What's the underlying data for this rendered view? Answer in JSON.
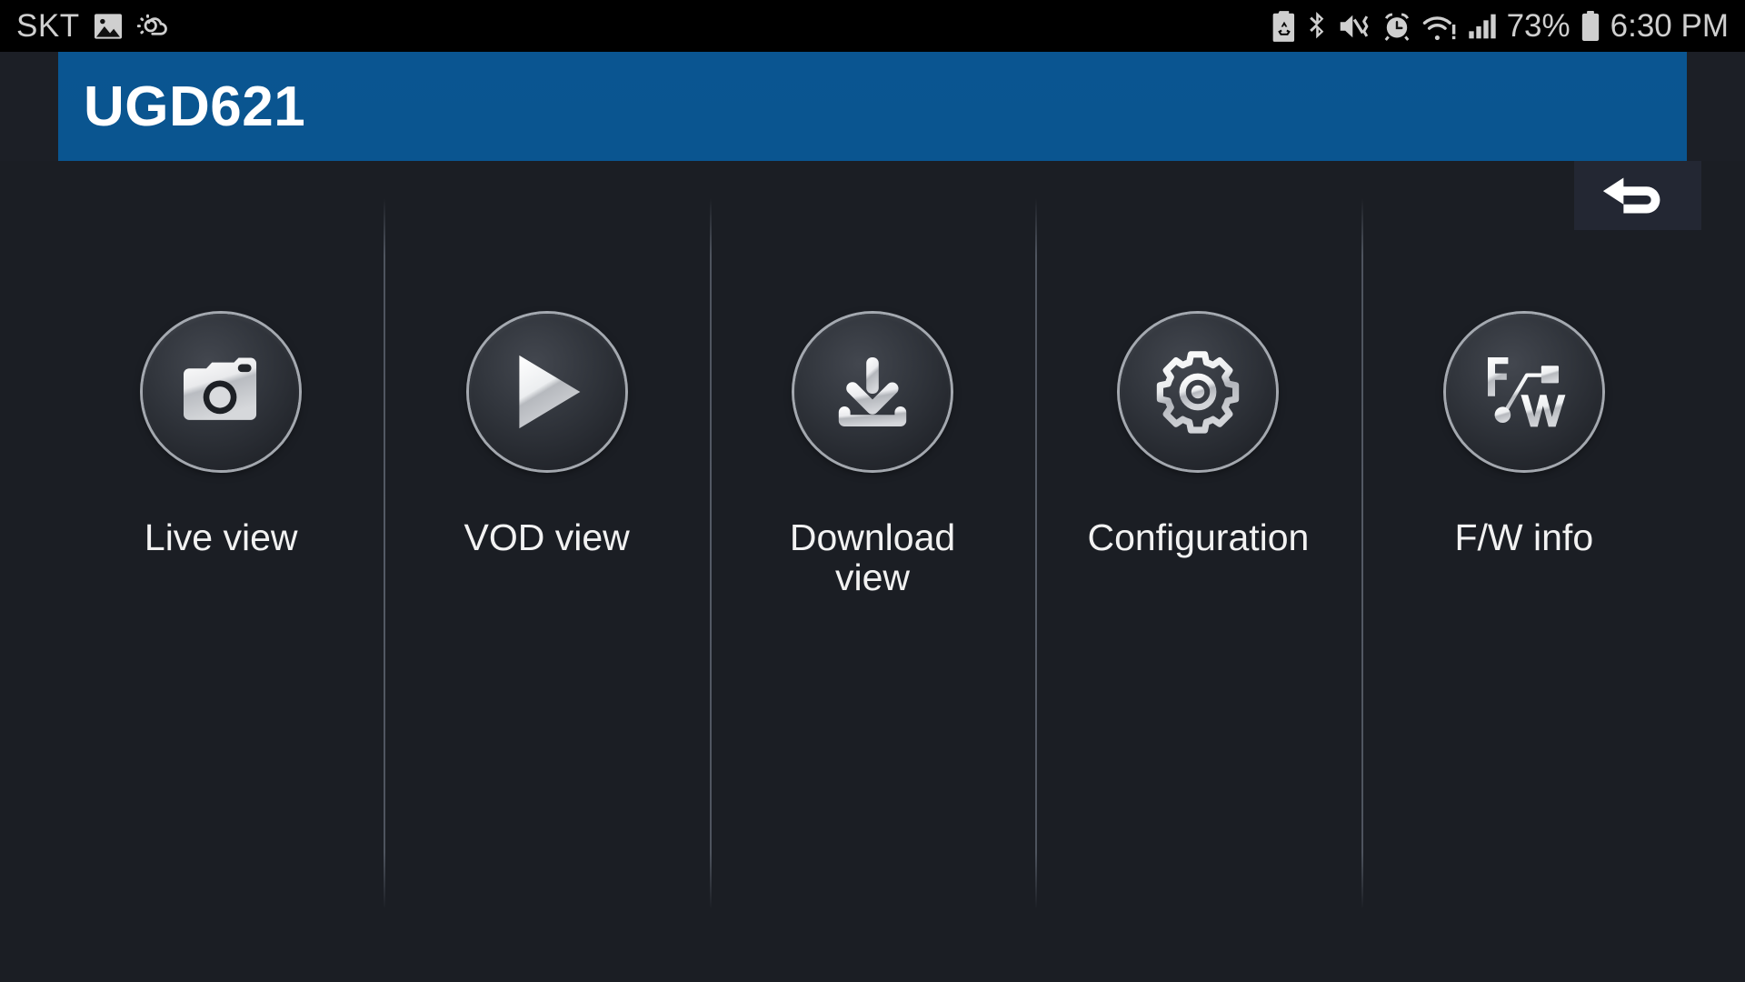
{
  "statusbar": {
    "carrier": "SKT",
    "left_icons": [
      "image-icon",
      "weather-partly-cloudy-icon"
    ],
    "right_icons": [
      "power-saving-icon",
      "bluetooth-icon",
      "mute-vibrate-icon",
      "alarm-clock-icon",
      "wifi-alert-icon",
      "cellular-signal-icon"
    ],
    "battery_percent": "73%",
    "battery_icon": "battery-icon",
    "time": "6:30 PM"
  },
  "appbar": {
    "title": "UGD621",
    "color": "#0a5590"
  },
  "back_button": {
    "name": "back-button",
    "icon": "undo-arrow-icon"
  },
  "tiles": [
    {
      "id": "live-view",
      "label": "Live view",
      "icon": "camera-icon"
    },
    {
      "id": "vod-view",
      "label": "VOD view",
      "icon": "play-icon"
    },
    {
      "id": "download-view",
      "label": "Download\nview",
      "icon": "download-icon"
    },
    {
      "id": "configuration",
      "label": "Configuration",
      "icon": "gear-icon"
    },
    {
      "id": "fw-info",
      "label": "F/W info",
      "icon": "firmware-icon"
    }
  ]
}
